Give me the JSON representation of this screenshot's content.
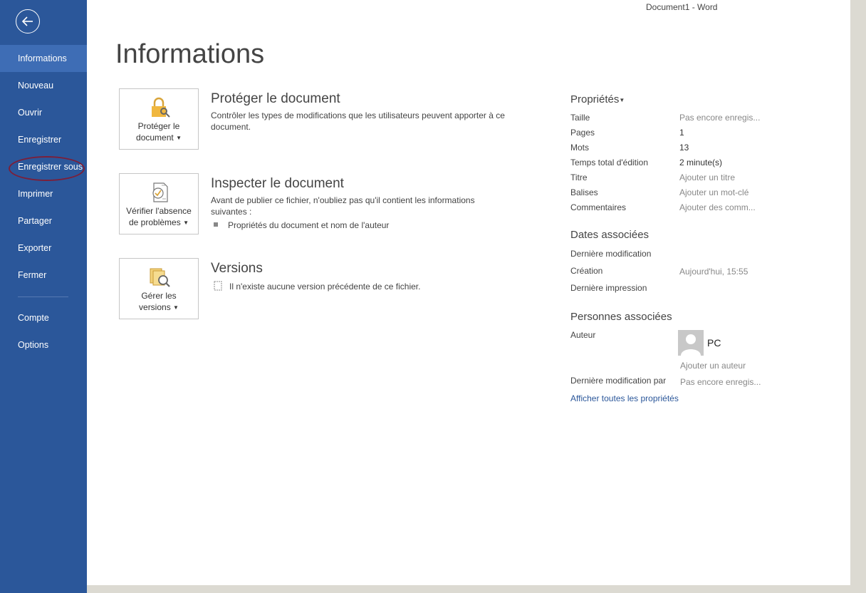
{
  "window_title": "Document1 - Word",
  "sidebar": {
    "items": [
      {
        "label": "Informations"
      },
      {
        "label": "Nouveau"
      },
      {
        "label": "Ouvrir"
      },
      {
        "label": "Enregistrer"
      },
      {
        "label": "Enregistrer sous"
      },
      {
        "label": "Imprimer"
      },
      {
        "label": "Partager"
      },
      {
        "label": "Exporter"
      },
      {
        "label": "Fermer"
      },
      {
        "label": "Compte"
      },
      {
        "label": "Options"
      }
    ],
    "active_color": "#3e6db5",
    "bg_color": "#2b579a"
  },
  "main": {
    "title": "Informations",
    "sections": [
      {
        "button_line1": "Protéger le",
        "button_line2": "document",
        "icon": "lock-key-icon",
        "title": "Protéger le document",
        "desc": "Contrôler les types de modifications que les utilisateurs peuvent apporter à ce document."
      },
      {
        "button_line1": "Vérifier l'absence",
        "button_line2": "de problèmes",
        "icon": "inspect-document-icon",
        "title": "Inspecter le document",
        "desc": "Avant de publier ce fichier, n'oubliez pas qu'il contient les informations suivantes :",
        "bullet": "Propriétés du document et nom de l'auteur"
      },
      {
        "button_line1": "Gérer les",
        "button_line2": "versions",
        "icon": "manage-versions-icon",
        "title": "Versions",
        "note": "Il n'existe aucune version précédente de ce fichier."
      }
    ]
  },
  "properties": {
    "heading": "Propriétés",
    "rows": [
      {
        "label": "Taille",
        "value": "Pas encore enregis..."
      },
      {
        "label": "Pages",
        "value": "1"
      },
      {
        "label": "Mots",
        "value": "13"
      },
      {
        "label": "Temps total d'édition",
        "value": "2 minute(s)"
      },
      {
        "label": "Titre",
        "value": "Ajouter un titre"
      },
      {
        "label": "Balises",
        "value": "Ajouter un mot-clé"
      },
      {
        "label": "Commentaires",
        "value": "Ajouter des comm..."
      }
    ],
    "dates_heading": "Dates associées",
    "dates": [
      {
        "label": "Dernière modification",
        "value": ""
      },
      {
        "label": "Création",
        "value": "Aujourd'hui, 15:55"
      },
      {
        "label": "Dernière impression",
        "value": ""
      }
    ],
    "people_heading": "Personnes associées",
    "author_label": "Auteur",
    "author_name": "PC",
    "add_author": "Ajouter un auteur",
    "last_modified_by_label": "Dernière modification par",
    "last_modified_by_value": "Pas encore enregis...",
    "show_all": "Afficher toutes les propriétés"
  }
}
